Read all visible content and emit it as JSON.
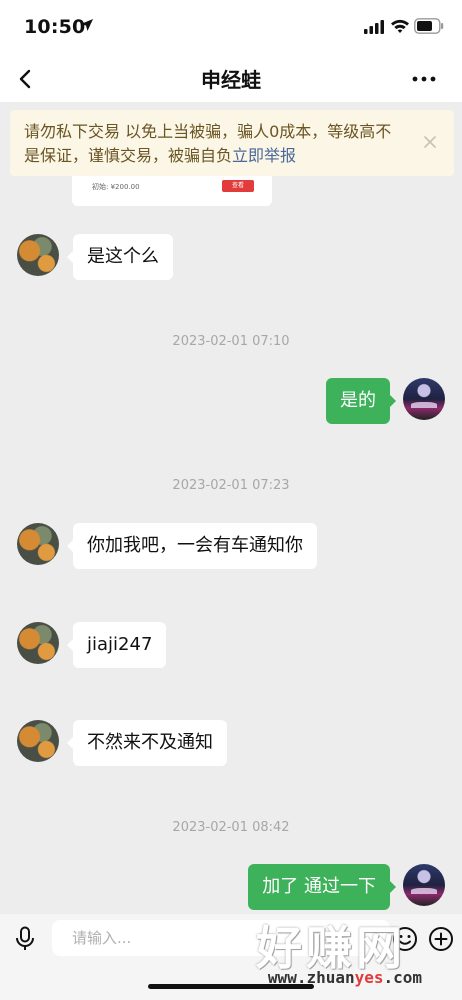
{
  "status_bar": {
    "time": "10:50"
  },
  "header": {
    "title": "申经蛙"
  },
  "notice": {
    "text": "请勿私下交易 以免上当被骗，骗人0成本，等级高不是保证，谨慎交易，被骗自负",
    "link": "立即举报"
  },
  "shared_card": {
    "price": "初始: ¥200.00",
    "button": "查看"
  },
  "messages": [
    {
      "side": "left",
      "text": "是这个么"
    },
    {
      "type": "time",
      "text": "2023-02-01 07:10"
    },
    {
      "side": "right",
      "text": "是的"
    },
    {
      "type": "time",
      "text": "2023-02-01 07:23"
    },
    {
      "side": "left",
      "text": "你加我吧，一会有车通知你"
    },
    {
      "side": "left",
      "text": "jiaji247"
    },
    {
      "side": "left",
      "text": "不然来不及通知"
    },
    {
      "type": "time",
      "text": "2023-02-01 08:42"
    },
    {
      "side": "right",
      "text": "加了 通过一下"
    }
  ],
  "input_bar": {
    "placeholder": "请输入..."
  },
  "watermark": {
    "logo": "好赚网",
    "url_prefix": "www.zhuan",
    "url_accent": "yes",
    "url_suffix": ".com"
  },
  "colors": {
    "sent_bubble": "#3eb25a",
    "notice_bg": "#fbf6e5",
    "link": "#4a6899"
  }
}
